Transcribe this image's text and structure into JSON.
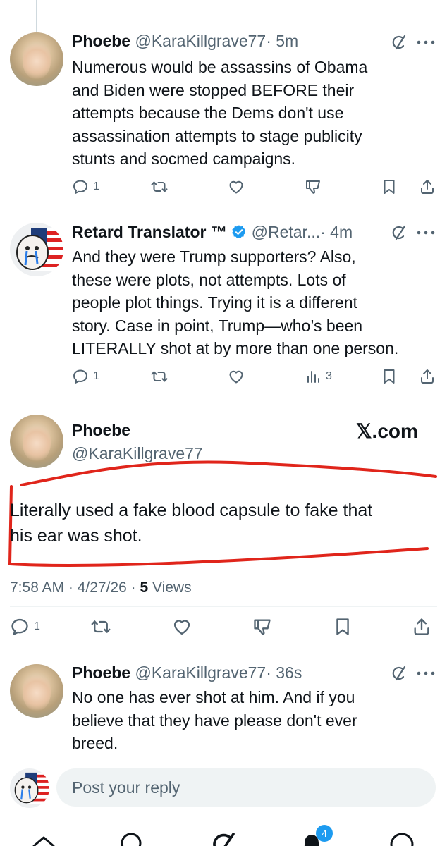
{
  "tweets": [
    {
      "name": "Phoebe",
      "handle": "@KaraKillgrave77",
      "time": "· 5m",
      "lines": [
        "Numerous would be assassins of Obama",
        "and Biden were stopped BEFORE their",
        "attempts because the Dems don't use",
        "assassination attempts to stage publicity",
        "stunts and socmed campaigns."
      ],
      "reply_count": "1"
    },
    {
      "name": "Retard Translator ™",
      "handle": "@Retar...",
      "time": "· 4m",
      "lines": [
        "And they were Trump supporters? Also,",
        "these were plots, not attempts. Lots of",
        "people plot things. Trying it is a different",
        "story. Case in point, Trump—who’s been",
        "LITERALLY shot at by more than one person."
      ],
      "reply_count": "1",
      "views_count": "3"
    },
    {
      "name": "Phoebe",
      "handle": "@KaraKillgrave77",
      "watermark": "𝕏.com",
      "lines": [
        "Literally used a fake blood capsule to fake that",
        "his ear was shot."
      ],
      "meta_time": "7:58 AM · 4/27/26 · ",
      "meta_views_num": "5",
      "meta_views_label": " Views",
      "reply_count": "1"
    },
    {
      "name": "Phoebe",
      "handle": "@KaraKillgrave77",
      "time": "· 36s",
      "lines": [
        "No one has ever shot at him. And if you",
        "believe that they have please don't ever",
        "breed."
      ]
    }
  ],
  "reply_placeholder": "Post your reply",
  "notification_badge": "4",
  "colors": {
    "text": "#0f1419",
    "secondary": "#536471",
    "verified": "#1d9bf0",
    "annotation": "#e0251b"
  },
  "icons": [
    "reply-icon",
    "retweet-icon",
    "like-icon",
    "dislike-icon",
    "views-icon",
    "bookmark-icon",
    "share-icon",
    "grok-icon",
    "more-icon",
    "verified-badge-icon",
    "home-icon",
    "search-icon",
    "notifications-icon",
    "profile-icon"
  ]
}
